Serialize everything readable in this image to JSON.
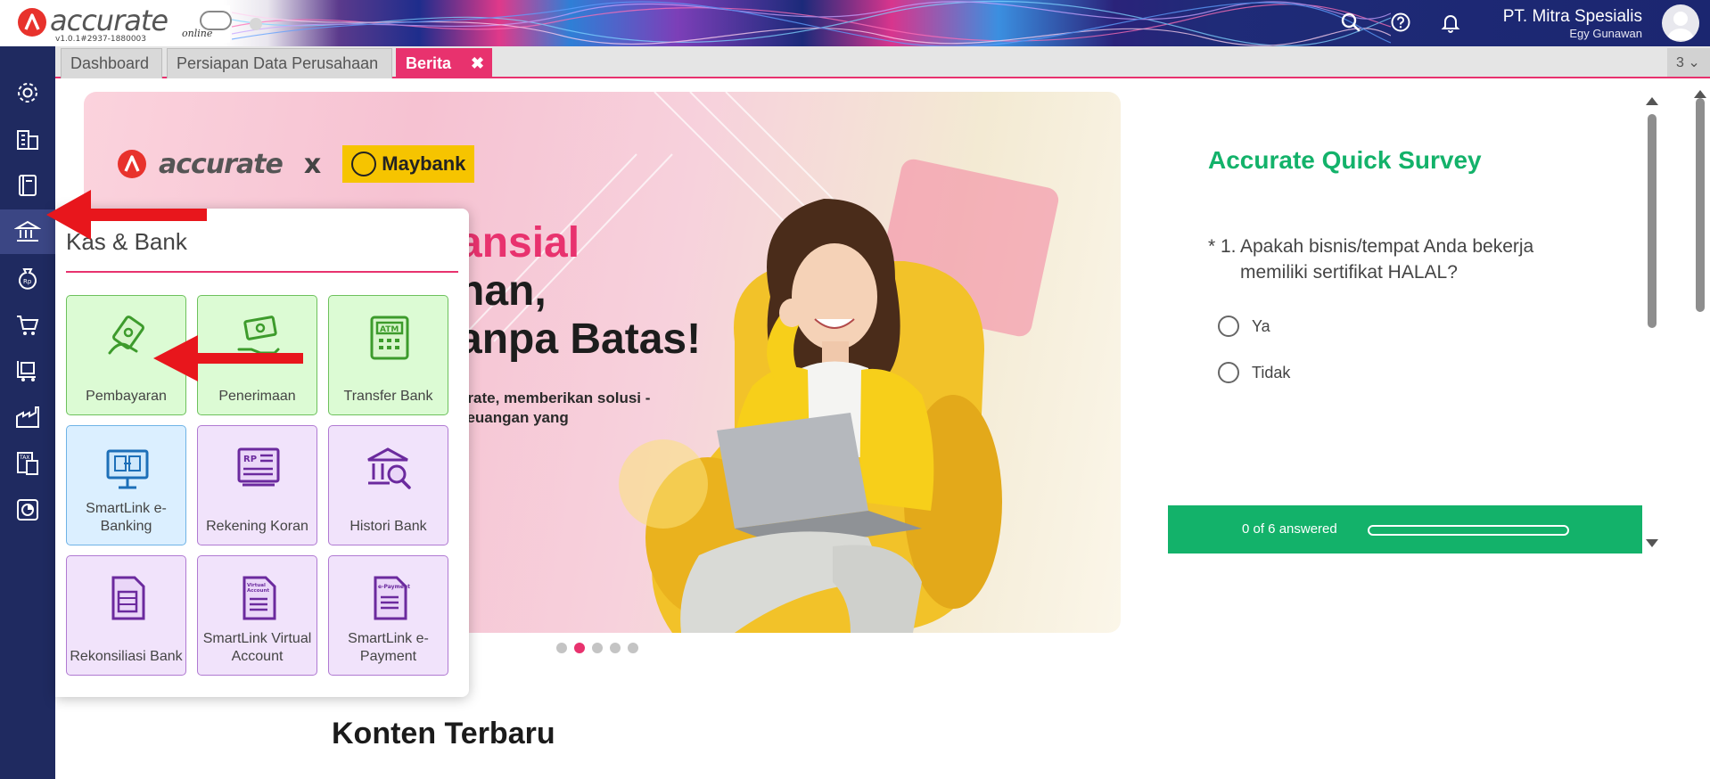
{
  "app": {
    "logo_word": "accurate",
    "logo_online": "online",
    "version": "v1.0.1#2937-1880003"
  },
  "header": {
    "company_name": "PT. Mitra Spesialis",
    "user_name": "Egy Gunawan",
    "icons": [
      "search-icon",
      "help-icon",
      "bell-icon"
    ]
  },
  "sidebar": {
    "items": [
      {
        "icon": "gear-icon"
      },
      {
        "icon": "building-icon"
      },
      {
        "icon": "book-icon"
      },
      {
        "icon": "bank-icon",
        "active": true
      },
      {
        "icon": "money-bag-icon"
      },
      {
        "icon": "cart-icon"
      },
      {
        "icon": "trolley-icon"
      },
      {
        "icon": "factory-icon"
      },
      {
        "icon": "tax-icon"
      },
      {
        "icon": "report-icon"
      }
    ]
  },
  "tabs": {
    "items": [
      {
        "label": "Dashboard"
      },
      {
        "label": "Persiapan Data Perusahaan"
      },
      {
        "label": "Berita",
        "active": true
      }
    ],
    "close_glyph": "✖",
    "count": "3 ⌄"
  },
  "banner": {
    "brand": "accurate",
    "x": "x",
    "partner": "Maybank",
    "line1": "ansial",
    "line2": "nan,",
    "line3": "anpa Batas!",
    "subtext": "urate, memberikan solusi -keuangan yang",
    "carousel_active_index": 1,
    "carousel_count": 5
  },
  "survey": {
    "title": "Accurate Quick Survey",
    "question_number": "* 1.",
    "question": "Apakah bisnis/tempat Anda bekerja memiliki sertifikat HALAL?",
    "options": [
      "Ya",
      "Tidak"
    ],
    "progress_text": "0 of 6 answered",
    "progress_fraction": 0
  },
  "content": {
    "heading": "Konten Terbaru"
  },
  "popup": {
    "title": "Kas & Bank",
    "tiles": [
      {
        "label": "Pembayaran",
        "icon": "payment-icon",
        "color": "green"
      },
      {
        "label": "Penerimaan",
        "icon": "receipt-money-icon",
        "color": "green"
      },
      {
        "label": "Transfer Bank",
        "icon": "atm-icon",
        "color": "green"
      },
      {
        "label": "SmartLink e-Banking",
        "icon": "ebanking-icon",
        "color": "blue"
      },
      {
        "label": "Rekening Koran",
        "icon": "bank-statement-icon",
        "color": "purple"
      },
      {
        "label": "Histori Bank",
        "icon": "bank-history-icon",
        "color": "purple"
      },
      {
        "label": "Rekonsiliasi Bank",
        "icon": "reconcile-icon",
        "color": "purple"
      },
      {
        "label": "SmartLink Virtual Account",
        "icon": "virtual-account-icon",
        "color": "purple"
      },
      {
        "label": "SmartLink e-Payment",
        "icon": "epayment-icon",
        "color": "purple"
      }
    ]
  },
  "colors": {
    "accent": "#e8326e",
    "sidebar": "#1f2a60",
    "survey_green": "#13b26a",
    "annotation_red": "#e8161c"
  }
}
